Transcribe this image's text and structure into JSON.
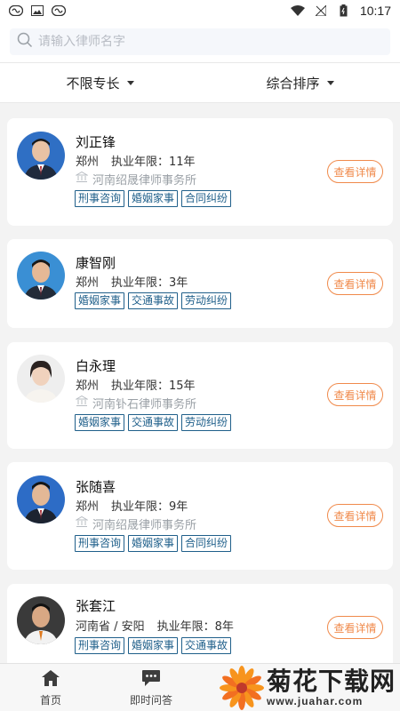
{
  "status_bar": {
    "time": "10:17"
  },
  "search": {
    "placeholder": "请输入律师名字"
  },
  "filters": [
    {
      "label": "不限专长"
    },
    {
      "label": "综合排序"
    }
  ],
  "detail_label": "查看详情",
  "lawyers": [
    {
      "name": "刘正锋",
      "city": "郑州",
      "years": "执业年限：11年",
      "firm": "河南绍晟律师事务所",
      "tags": [
        "刑事咨询",
        "婚姻家事",
        "合同纠纷"
      ]
    },
    {
      "name": "康智刚",
      "city": "郑州",
      "years": "执业年限：3年",
      "firm": "",
      "tags": [
        "婚姻家事",
        "交通事故",
        "劳动纠纷"
      ]
    },
    {
      "name": "白永理",
      "city": "郑州",
      "years": "执业年限：15年",
      "firm": "河南钋石律师事务所",
      "tags": [
        "婚姻家事",
        "交通事故",
        "劳动纠纷"
      ]
    },
    {
      "name": "张随喜",
      "city": "郑州",
      "years": "执业年限：9年",
      "firm": "河南绍晟律师事务所",
      "tags": [
        "刑事咨询",
        "婚姻家事",
        "合同纠纷"
      ]
    },
    {
      "name": "张套江",
      "city": "河南省 / 安阳",
      "years": "执业年限：8年",
      "firm": "",
      "tags": [
        "刑事咨询",
        "婚姻家事",
        "交通事故"
      ]
    }
  ],
  "tabbar": [
    {
      "label": "首页",
      "icon": "home-icon"
    },
    {
      "label": "即时问答",
      "icon": "chat-icon"
    }
  ],
  "watermark": {
    "title": "菊花下载网",
    "url": "www.juahar.com"
  },
  "colors": {
    "accent": "#f08a4b",
    "tag": "#1f5f8a",
    "background": "#f3f3f3"
  }
}
